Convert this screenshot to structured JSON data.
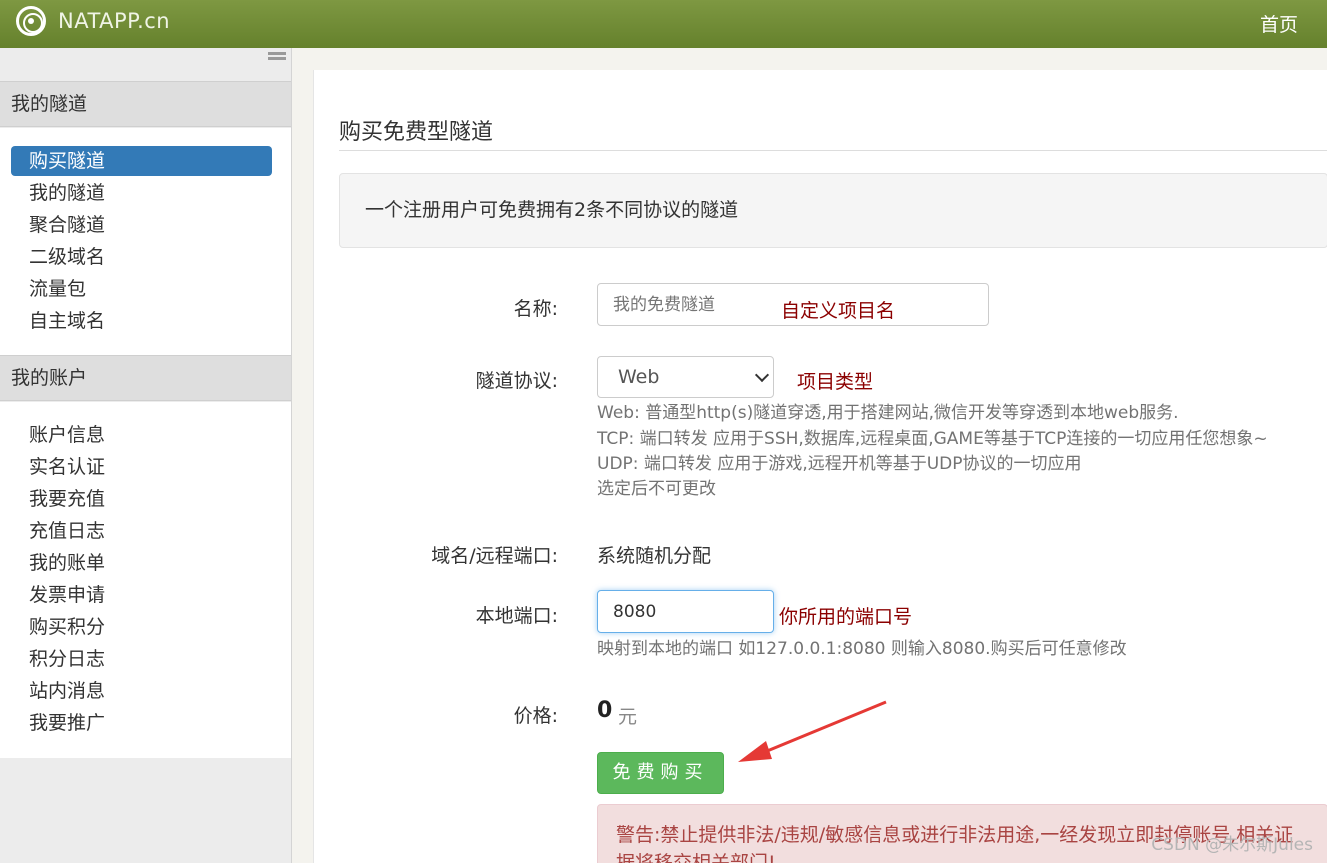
{
  "header": {
    "brand": "NATAPP.cn",
    "nav_home": "首页"
  },
  "sidebar": {
    "group1_title": "我的隧道",
    "group1_items": [
      "购买隧道",
      "我的隧道",
      "聚合隧道",
      "二级域名",
      "流量包",
      "自主域名"
    ],
    "group2_title": "我的账户",
    "group2_items": [
      "账户信息",
      "实名认证",
      "我要充值",
      "充值日志",
      "我的账单",
      "发票申请",
      "购买积分",
      "积分日志",
      "站内消息",
      "我要推广"
    ]
  },
  "main": {
    "title": "购买免费型隧道",
    "notice": "一个注册用户可免费拥有2条不同协议的隧道",
    "name_label": "名称:",
    "name_placeholder": "我的免费隧道",
    "name_annotation": "自定义项目名",
    "protocol_label": "隧道协议:",
    "protocol_value": "Web",
    "protocol_annotation": "项目类型",
    "protocol_help": [
      "Web: 普通型http(s)隧道穿透,用于搭建网站,微信开发等穿透到本地web服务.",
      "TCP: 端口转发 应用于SSH,数据库,远程桌面,GAME等基于TCP连接的一切应用任您想象~",
      "UDP: 端口转发 应用于游戏,远程开机等基于UDP协议的一切应用",
      "选定后不可更改"
    ],
    "domain_label": "域名/远程端口:",
    "domain_value": "系统随机分配",
    "port_label": "本地端口:",
    "port_value": "8080",
    "port_annotation": "你所用的端口号",
    "port_help": "映射到本地的端口 如127.0.0.1:8080 则输入8080.购买后可任意修改",
    "price_label": "价格:",
    "price_value": "0",
    "price_unit": "元",
    "buy_button": "免费购买",
    "warning_line1": "警告:禁止提供非法/违规/敏感信息或进行非法用途,一经发现立即封停账号,相关证",
    "warning_line2": "据将移交相关部门!"
  },
  "watermark": "CSDN @朱尔斯Jules",
  "colors": {
    "nav": "#6f8a34",
    "active": "#337ab7",
    "button": "#5cb85c",
    "annotation": "#8b0000",
    "arrow": "#e53935"
  }
}
